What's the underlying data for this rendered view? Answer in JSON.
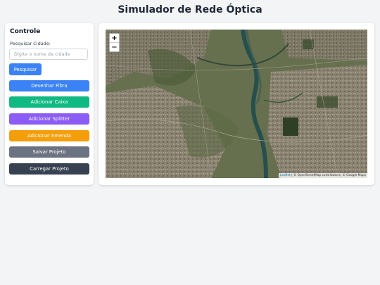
{
  "header": {
    "title": "Simulador de Rede Óptica"
  },
  "sidebar": {
    "heading": "Controle",
    "search": {
      "label": "Pesquisar Cidade:",
      "placeholder": "Digite o nome da cidade",
      "value": "",
      "button_label": "Pesquisar"
    },
    "buttons": [
      {
        "label": "Desenhar Fibra",
        "color": "#3b82f6"
      },
      {
        "label": "Adicionar Caixa",
        "color": "#10b981"
      },
      {
        "label": "Adicionar Splitter",
        "color": "#8b5cf6"
      },
      {
        "label": "Adicionar Emenda",
        "color": "#f59e0b"
      },
      {
        "label": "Salvar Projeto",
        "color": "#6b7280"
      },
      {
        "label": "Carregar Projeto",
        "color": "#374151"
      }
    ]
  },
  "map": {
    "layer": "satellite",
    "zoom_in_label": "+",
    "zoom_out_label": "−",
    "attribution": {
      "leaflet": "Leaflet",
      "separator": " | © ",
      "osm": "OpenStreetMap contributors",
      "google": ", © Google Maps"
    }
  }
}
